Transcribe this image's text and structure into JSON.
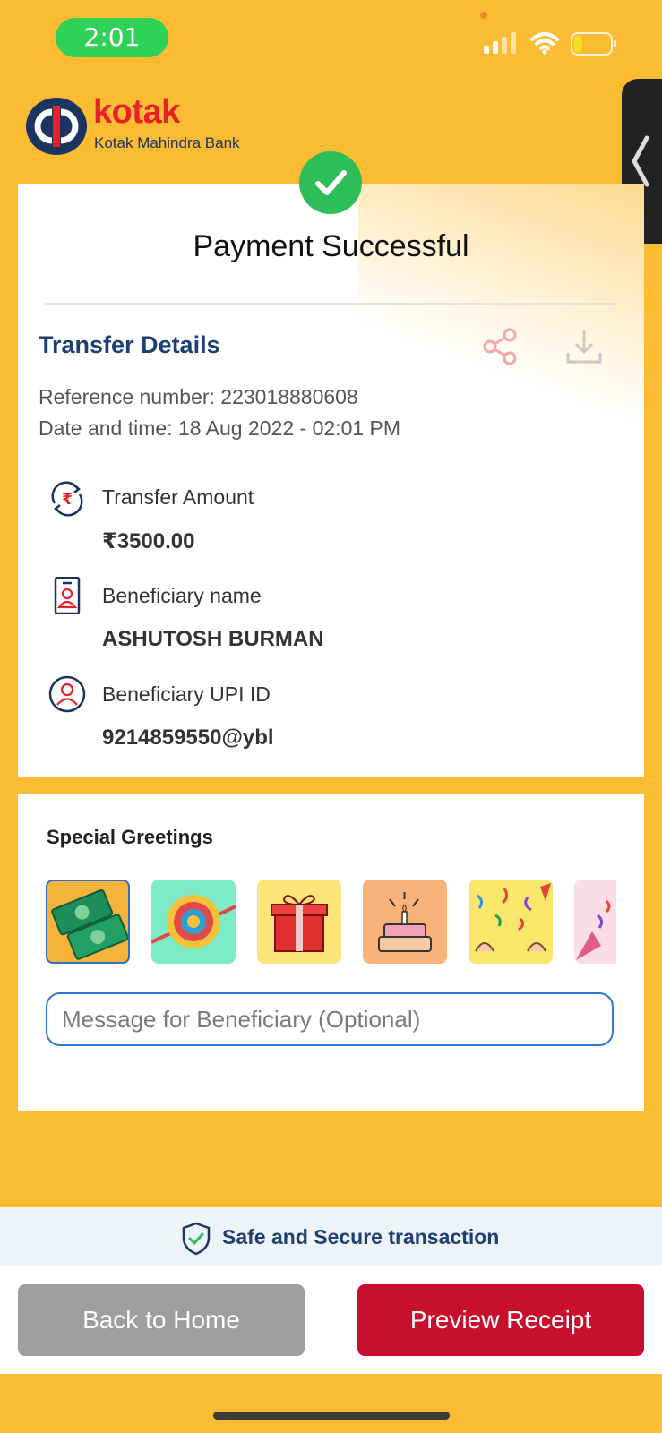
{
  "status_bar": {
    "time": "2:01"
  },
  "brand": {
    "name": "kotak",
    "subtitle": "Kotak Mahindra Bank"
  },
  "receipt": {
    "title": "Payment Successful",
    "section_title": "Transfer Details",
    "reference_line": "Reference number: 223018880608",
    "datetime_line": "Date and time: 18 Aug 2022 - 02:01 PM",
    "rows": [
      {
        "label": "Transfer Amount",
        "value": "₹3500.00",
        "icon": "rupee-transfer-icon"
      },
      {
        "label": "Beneficiary name",
        "value": "ASHUTOSH BURMAN",
        "icon": "id-card-icon"
      },
      {
        "label": "Beneficiary UPI ID",
        "value": "9214859550@ybl",
        "icon": "user-circle-icon"
      }
    ]
  },
  "greetings": {
    "title": "Special Greetings",
    "cards": [
      "money-greeting",
      "rakhi-greeting",
      "gift-greeting",
      "cake-greeting",
      "confetti-greeting",
      "party-popper-greeting"
    ],
    "message_placeholder": "Message for Beneficiary (Optional)",
    "message_value": ""
  },
  "footer": {
    "secure_text": "Safe and Secure transaction",
    "back_label": "Back to Home",
    "preview_label": "Preview Receipt"
  },
  "colors": {
    "background": "#FBBB33",
    "brand_red": "#E8202A",
    "navy": "#1D3F72",
    "success_green": "#2DBE5A",
    "primary_button": "#C8102E",
    "secondary_button": "#9E9E9E"
  }
}
